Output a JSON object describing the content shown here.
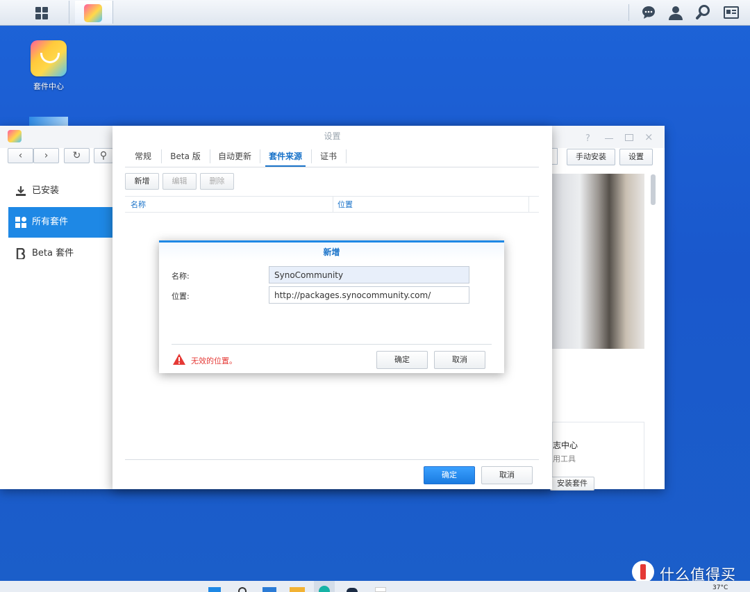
{
  "taskbar": {
    "icons": [
      "grid-icon",
      "package-center-icon",
      "chat-icon",
      "user-icon",
      "search-icon",
      "widget-icon"
    ]
  },
  "desktop": {
    "icon_label": "套件中心"
  },
  "package_center": {
    "sidebar": [
      {
        "label": "已安装",
        "icon": "download-icon"
      },
      {
        "label": "所有套件",
        "icon": "grid-icon"
      },
      {
        "label": "Beta 套件",
        "icon": "beta-icon"
      }
    ],
    "manual_install": "手动安装",
    "settings_btn": "设置",
    "right_panel": {
      "title": "志中心",
      "sub": "用工具",
      "install_btn": "安装套件"
    }
  },
  "settings_dialog": {
    "title": "设置",
    "tabs": [
      "常规",
      "Beta 版",
      "自动更新",
      "套件来源",
      "证书"
    ],
    "active_tab": "套件来源",
    "toolbar": {
      "add": "新增",
      "edit": "编辑",
      "delete": "删除"
    },
    "columns": [
      "名称",
      "位置"
    ],
    "ok": "确定",
    "cancel": "取消"
  },
  "new_dialog": {
    "title": "新增",
    "name_label": "名称:",
    "name_value": "SynoCommunity",
    "location_label": "位置:",
    "location_value": "http://packages.synocommunity.com/",
    "error": "无效的位置。",
    "ok": "确定",
    "cancel": "取消"
  },
  "watermark": "什么值得买",
  "tray": {
    "temp": "37°C"
  }
}
